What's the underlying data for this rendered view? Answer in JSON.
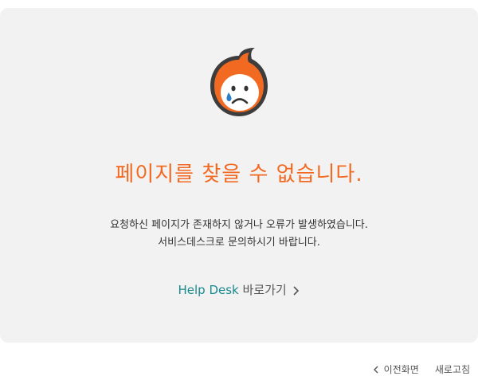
{
  "error": {
    "title": "페이지를 찾을 수 없습니다.",
    "description_line1": "요청하신 페이지가 존재하지 않거나 오류가 발생하였습니다.",
    "description_line2": "서비스데스크로 문의하시기 바랍니다."
  },
  "helpdesk": {
    "label_en": "Help Desk",
    "label_ko": "바로가기",
    "icon": "chevron-right-icon"
  },
  "footer": {
    "back_label": "이전화면",
    "back_icon": "chevron-left-icon",
    "refresh_label": "새로고침"
  },
  "colors": {
    "accent_orange": "#f26a22",
    "link_teal": "#1a8a8f",
    "card_bg": "#f2f2f2",
    "tear_blue": "#2a7fc8"
  }
}
